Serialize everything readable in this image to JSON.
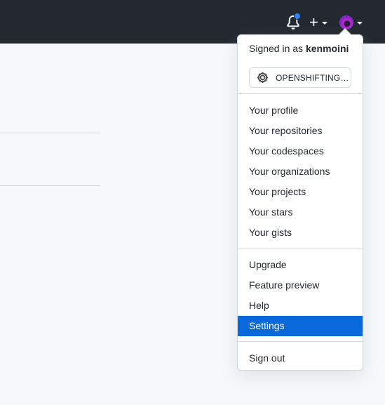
{
  "header": {
    "notification_icon": "bell-icon",
    "create_icon": "plus-icon",
    "avatar_icon": "user-avatar"
  },
  "menu": {
    "signed_in_prefix": "Signed in as",
    "username": "kenmoini",
    "status_label": "OPENSHIFTING I...",
    "status_icon": "gear-emoji-icon",
    "group1": [
      "Your profile",
      "Your repositories",
      "Your codespaces",
      "Your organizations",
      "Your projects",
      "Your stars",
      "Your gists"
    ],
    "group2": [
      "Upgrade",
      "Feature preview",
      "Help",
      "Settings"
    ],
    "sign_out": "Sign out",
    "active_item": "Settings"
  },
  "colors": {
    "header_bg": "#24292f",
    "accent": "#0969da",
    "notification_dot": "#2f81f7"
  }
}
